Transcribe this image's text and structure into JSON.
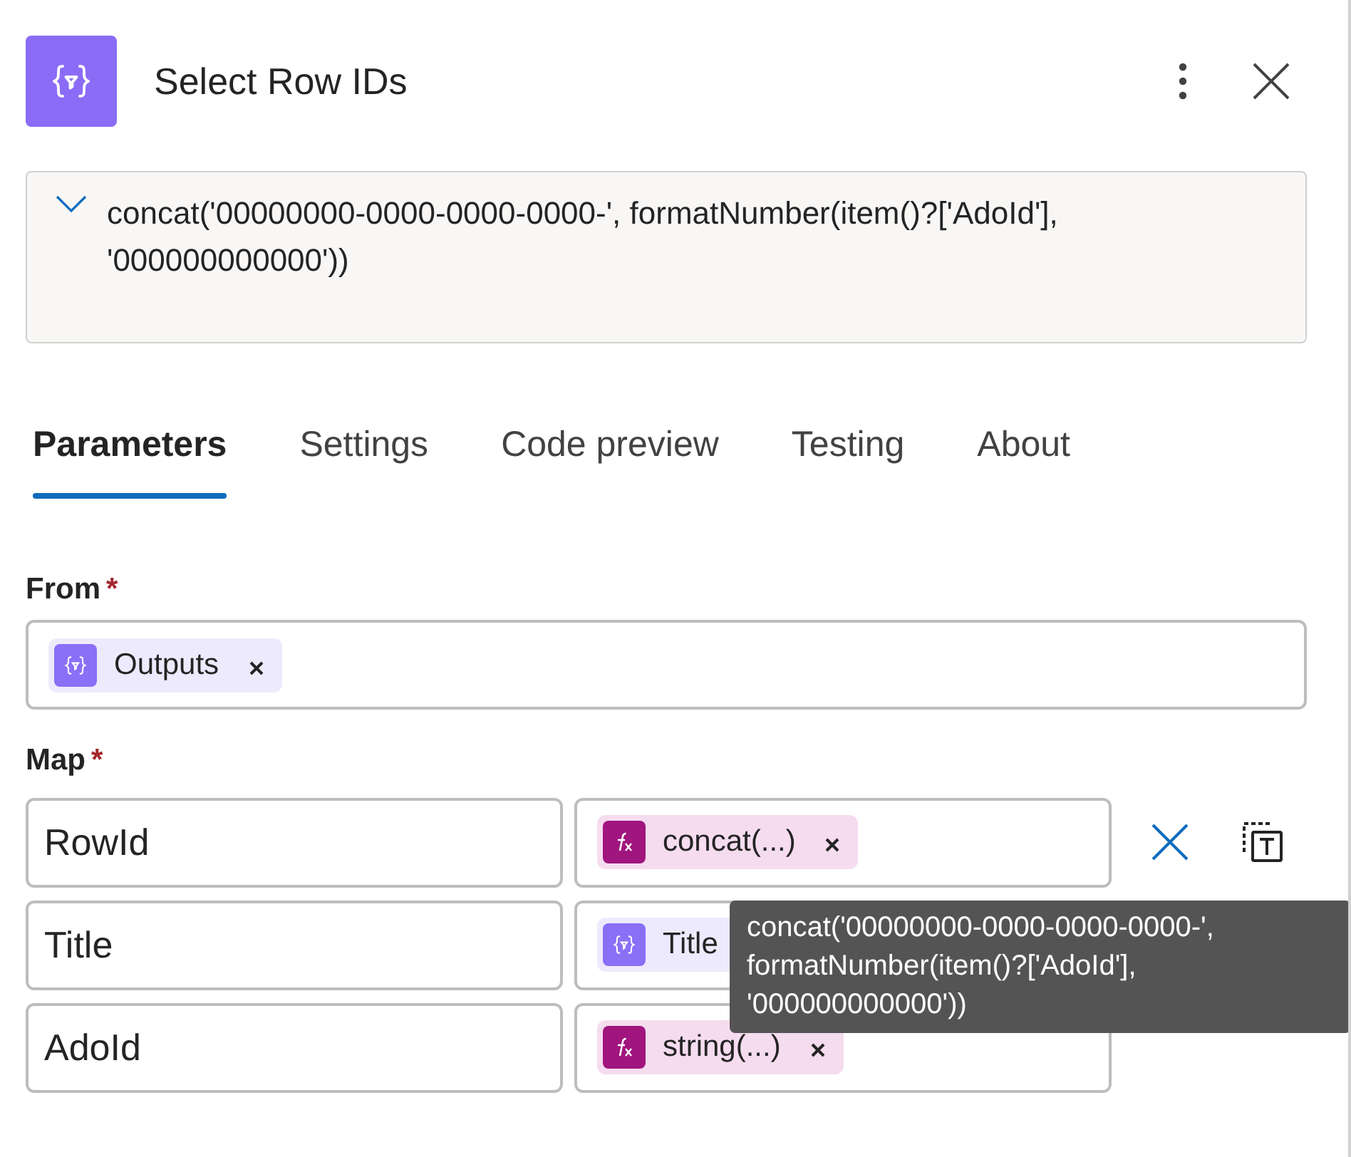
{
  "header": {
    "title": "Select Row IDs"
  },
  "expression": {
    "expanded": false,
    "text": "concat('00000000-0000-0000-0000-', formatNumber(item()?['AdoId'], '000000000000'))"
  },
  "tabs": [
    {
      "label": "Parameters",
      "selected": true
    },
    {
      "label": "Settings",
      "selected": false
    },
    {
      "label": "Code preview",
      "selected": false
    },
    {
      "label": "Testing",
      "selected": false
    },
    {
      "label": "About",
      "selected": false
    }
  ],
  "from": {
    "label": "From",
    "required": "*",
    "tokens": [
      {
        "kind": "dynamic",
        "label": "Outputs",
        "removable": true
      }
    ]
  },
  "map": {
    "label": "Map",
    "required": "*",
    "rows": [
      {
        "key": "RowId",
        "value": {
          "kind": "expression",
          "label": "concat(...)",
          "removable": true
        },
        "actions_visible": true
      },
      {
        "key": "Title",
        "value": {
          "kind": "dynamic",
          "label": "Title",
          "removable": false
        },
        "actions_visible": false
      },
      {
        "key": "AdoId",
        "value": {
          "kind": "expression",
          "label": "string(...)",
          "removable": true
        },
        "actions_visible": false
      }
    ]
  },
  "tooltip": {
    "text": "concat('00000000-0000-0000-0000-', formatNumber(item()?['AdoId'], '000000000000'))"
  }
}
